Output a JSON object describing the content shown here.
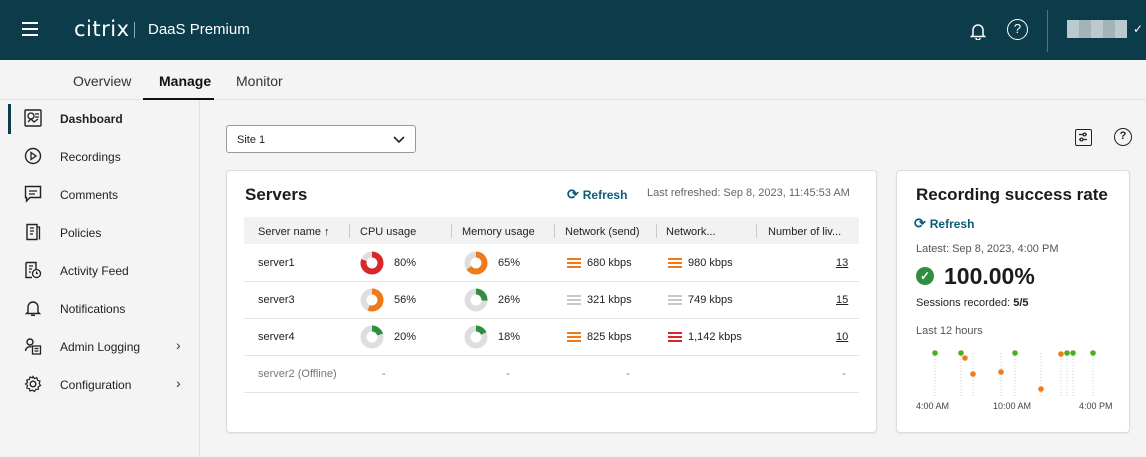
{
  "header": {
    "brand": "citrix",
    "product": "DaaS Premium",
    "help_label": "?"
  },
  "tabs": [
    {
      "label": "Overview",
      "active": false
    },
    {
      "label": "Manage",
      "active": true
    },
    {
      "label": "Monitor",
      "active": false
    }
  ],
  "sidebar": {
    "items": [
      {
        "label": "Dashboard",
        "icon": "dashboard-icon",
        "active": true
      },
      {
        "label": "Recordings",
        "icon": "play-circle-icon"
      },
      {
        "label": "Comments",
        "icon": "comment-icon"
      },
      {
        "label": "Policies",
        "icon": "policy-document-icon"
      },
      {
        "label": "Activity Feed",
        "icon": "activity-feed-icon"
      },
      {
        "label": "Notifications",
        "icon": "bell-icon"
      },
      {
        "label": "Admin Logging",
        "icon": "admin-logging-icon",
        "expandable": true
      },
      {
        "label": "Configuration",
        "icon": "gear-icon",
        "expandable": true
      }
    ]
  },
  "site_select": {
    "value": "Site 1"
  },
  "servers": {
    "title": "Servers",
    "refresh_label": "Refresh",
    "last_refreshed": "Last refreshed: Sep 8, 2023, 11:45:53 AM",
    "columns": [
      "Server name ↑",
      "CPU usage",
      "Memory usage",
      "Network (send)",
      "Network...",
      "Number of liv..."
    ],
    "rows": [
      {
        "name": "server1",
        "cpu": "80%",
        "cpu_value": 80,
        "cpu_color": "#d9262b",
        "mem": "65%",
        "mem_value": 65,
        "mem_color": "#f07a1a",
        "send": "680 kbps",
        "send_color": "#f07a1a",
        "recv": "980 kbps",
        "recv_color": "#f07a1a",
        "live": "13",
        "offline": false
      },
      {
        "name": "server3",
        "cpu": "56%",
        "cpu_value": 56,
        "cpu_color": "#f07a1a",
        "mem": "26%",
        "mem_value": 26,
        "mem_color": "#2f8f3e",
        "send": "321 kbps",
        "send_color": "#c8c8c8",
        "recv": "749 kbps",
        "recv_color": "#c8c8c8",
        "live": "15",
        "offline": false
      },
      {
        "name": "server4",
        "cpu": "20%",
        "cpu_value": 20,
        "cpu_color": "#2f8f3e",
        "mem": "18%",
        "mem_value": 18,
        "mem_color": "#2f8f3e",
        "send": "825 kbps",
        "send_color": "#f07a1a",
        "recv": "1,142 kbps",
        "recv_color": "#d9262b",
        "live": "10",
        "offline": false
      },
      {
        "name": "server2 (Offline)",
        "cpu": "-",
        "mem": "-",
        "send": "-",
        "recv": "-",
        "live": "-",
        "offline": true
      }
    ]
  },
  "recording": {
    "title": "Recording success rate",
    "refresh_label": "Refresh",
    "latest": "Latest: Sep 8, 2023, 4:00 PM",
    "rate": "100.00%",
    "sessions_label": "Sessions recorded:",
    "sessions_value": "5/5",
    "window_label": "Last 12 hours",
    "x_ticks": [
      "4:00 AM",
      "10:00 AM",
      "4:00 PM"
    ],
    "colors": {
      "success": "#4caf1f",
      "partial": "#f07a1a"
    }
  }
}
